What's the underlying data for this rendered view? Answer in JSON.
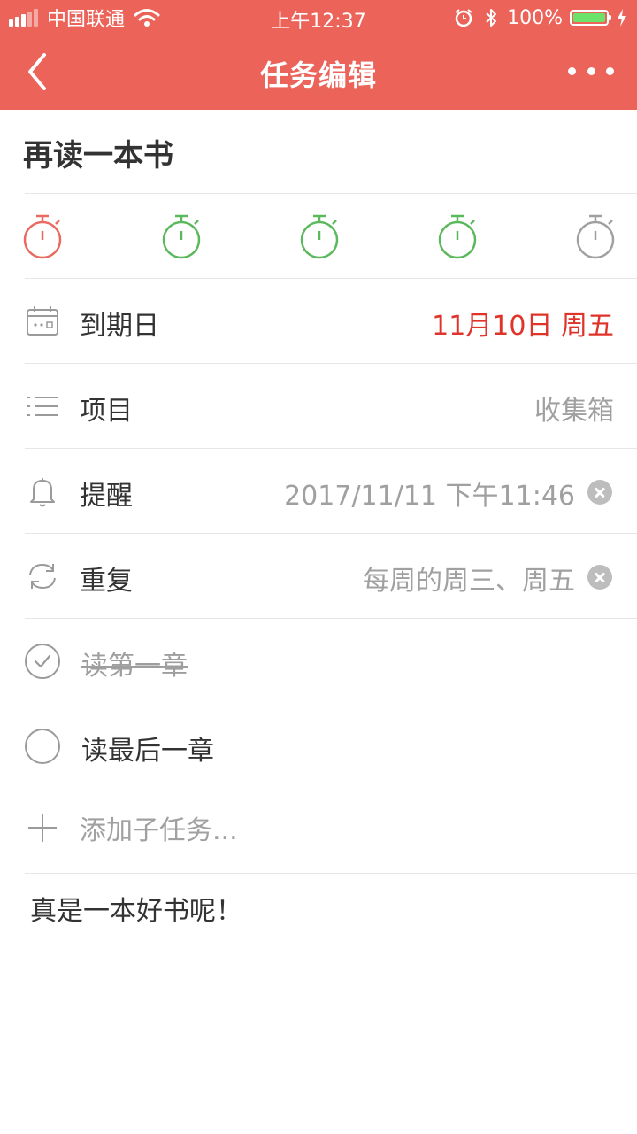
{
  "status_bar": {
    "carrier": "中国联通",
    "time": "上午12:37",
    "battery_percent": "100%"
  },
  "nav": {
    "title": "任务编辑"
  },
  "task": {
    "title": "再读一本书",
    "note": "真是一本好书呢！"
  },
  "pomodoros": [
    {
      "status": "active",
      "color": "#E86A60"
    },
    {
      "status": "done",
      "color": "#5CB85C"
    },
    {
      "status": "done",
      "color": "#5CB85C"
    },
    {
      "status": "done",
      "color": "#5CB85C"
    },
    {
      "status": "empty",
      "color": "#A0A0A0"
    }
  ],
  "fields": {
    "due_date": {
      "label": "到期日",
      "value": "11月10日 周五",
      "icon": "calendar-icon",
      "color": "#E0332A"
    },
    "project": {
      "label": "项目",
      "value": "收集箱",
      "icon": "list-icon"
    },
    "reminder": {
      "label": "提醒",
      "value": "2017/11/11 下午11:46",
      "icon": "bell-icon"
    },
    "repeat": {
      "label": "重复",
      "value": "每周的周三、周五",
      "icon": "repeat-icon"
    }
  },
  "subtasks": [
    {
      "label": "读第一章",
      "done": true
    },
    {
      "label": "读最后一章",
      "done": false
    }
  ],
  "add_subtask": {
    "label": "添加子任务..."
  },
  "colors": {
    "header": "#EC635A",
    "accent_red": "#E0332A",
    "green": "#5CB85C"
  }
}
